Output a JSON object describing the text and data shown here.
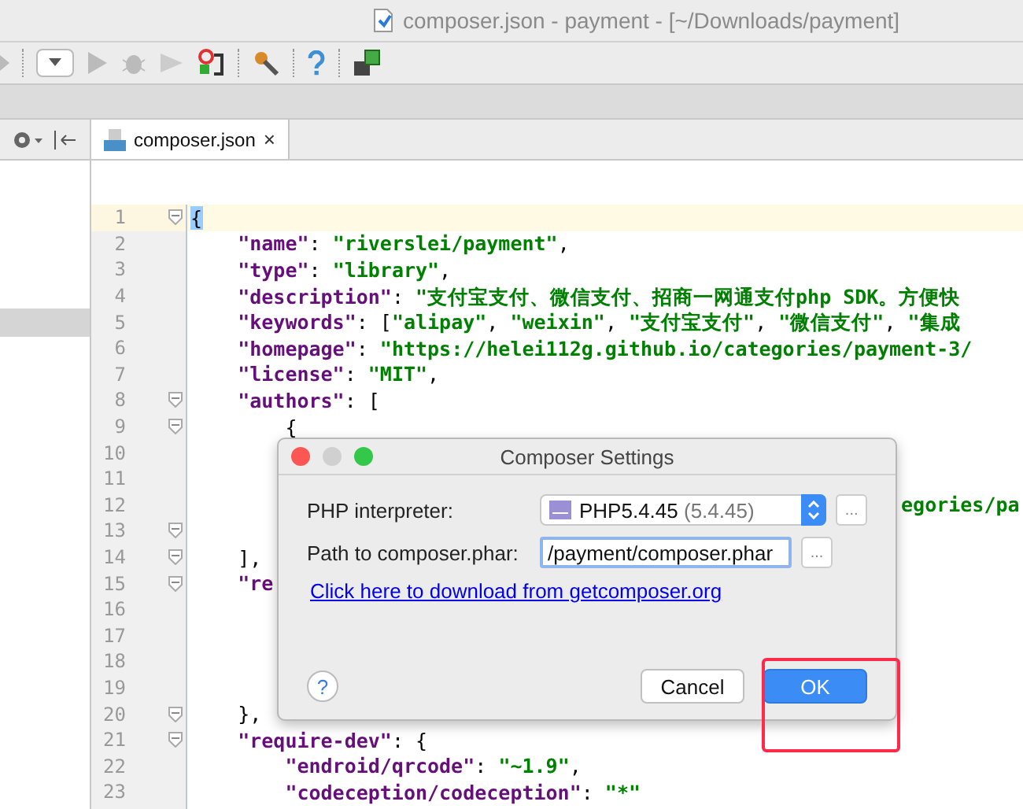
{
  "window": {
    "title": "composer.json - payment - [~/Downloads/payment]"
  },
  "tabs": [
    {
      "label": "composer.json",
      "close": "×",
      "selected": true
    }
  ],
  "editor": {
    "lines": [
      {
        "number": "1",
        "fold": true,
        "current": true,
        "tokens": [
          {
            "t": "{",
            "kind": "match"
          }
        ]
      },
      {
        "number": "2",
        "fold": false,
        "current": false,
        "tokens": [
          {
            "t": "    \"name\"",
            "kind": "key"
          },
          {
            "t": ": ",
            "kind": "p"
          },
          {
            "t": "\"riverslei/payment\"",
            "kind": "str"
          },
          {
            "t": ",",
            "kind": "p"
          }
        ]
      },
      {
        "number": "3",
        "fold": false,
        "current": false,
        "tokens": [
          {
            "t": "    \"type\"",
            "kind": "key"
          },
          {
            "t": ": ",
            "kind": "p"
          },
          {
            "t": "\"library\"",
            "kind": "str"
          },
          {
            "t": ",",
            "kind": "p"
          }
        ]
      },
      {
        "number": "4",
        "fold": false,
        "current": false,
        "tokens": [
          {
            "t": "    \"description\"",
            "kind": "key"
          },
          {
            "t": ": ",
            "kind": "p"
          },
          {
            "t": "\"支付宝支付、微信支付、招商一网通支付php SDK。方便快",
            "kind": "str"
          }
        ]
      },
      {
        "number": "5",
        "fold": false,
        "current": false,
        "tokens": [
          {
            "t": "    \"keywords\"",
            "kind": "key"
          },
          {
            "t": ": [",
            "kind": "p"
          },
          {
            "t": "\"alipay\"",
            "kind": "str"
          },
          {
            "t": ", ",
            "kind": "p"
          },
          {
            "t": "\"weixin\"",
            "kind": "str"
          },
          {
            "t": ", ",
            "kind": "p"
          },
          {
            "t": "\"支付宝支付\"",
            "kind": "str"
          },
          {
            "t": ", ",
            "kind": "p"
          },
          {
            "t": "\"微信支付\"",
            "kind": "str"
          },
          {
            "t": ", ",
            "kind": "p"
          },
          {
            "t": "\"集成",
            "kind": "str"
          }
        ]
      },
      {
        "number": "6",
        "fold": false,
        "current": false,
        "tokens": [
          {
            "t": "    \"homepage\"",
            "kind": "key"
          },
          {
            "t": ": ",
            "kind": "p"
          },
          {
            "t": "\"https://helei112g.github.io/categories/payment-3/",
            "kind": "str"
          }
        ]
      },
      {
        "number": "7",
        "fold": false,
        "current": false,
        "tokens": [
          {
            "t": "    \"license\"",
            "kind": "key"
          },
          {
            "t": ": ",
            "kind": "p"
          },
          {
            "t": "\"MIT\"",
            "kind": "str"
          },
          {
            "t": ",",
            "kind": "p"
          }
        ]
      },
      {
        "number": "8",
        "fold": true,
        "current": false,
        "tokens": [
          {
            "t": "    \"authors\"",
            "kind": "key"
          },
          {
            "t": ": [",
            "kind": "p"
          }
        ]
      },
      {
        "number": "9",
        "fold": true,
        "current": false,
        "tokens": [
          {
            "t": "        {",
            "kind": "p"
          }
        ]
      },
      {
        "number": "10",
        "fold": false,
        "current": false
      },
      {
        "number": "11",
        "fold": false,
        "current": false
      },
      {
        "number": "12",
        "fold": false,
        "current": false,
        "tokens": [
          {
            "t": "                                                            egories/pa",
            "kind": "str"
          }
        ]
      },
      {
        "number": "13",
        "fold": true,
        "current": false
      },
      {
        "number": "14",
        "fold": true,
        "current": false,
        "tokens": [
          {
            "t": "    ],",
            "kind": "p"
          }
        ]
      },
      {
        "number": "15",
        "fold": true,
        "current": false,
        "tokens": [
          {
            "t": "    \"re",
            "kind": "key"
          }
        ]
      },
      {
        "number": "16",
        "fold": false,
        "current": false
      },
      {
        "number": "17",
        "fold": false,
        "current": false
      },
      {
        "number": "18",
        "fold": false,
        "current": false
      },
      {
        "number": "19",
        "fold": false,
        "current": false
      },
      {
        "number": "20",
        "fold": true,
        "current": false,
        "tokens": [
          {
            "t": "    },",
            "kind": "p"
          }
        ]
      },
      {
        "number": "21",
        "fold": true,
        "current": false,
        "tokens": [
          {
            "t": "    \"require-dev\"",
            "kind": "key"
          },
          {
            "t": ": {",
            "kind": "p"
          }
        ]
      },
      {
        "number": "22",
        "fold": false,
        "current": false,
        "tokens": [
          {
            "t": "        \"endroid/qrcode\"",
            "kind": "key"
          },
          {
            "t": ": ",
            "kind": "p"
          },
          {
            "t": "\"~1.9\"",
            "kind": "str"
          },
          {
            "t": ",",
            "kind": "p"
          }
        ]
      },
      {
        "number": "23",
        "fold": false,
        "current": false,
        "tokens": [
          {
            "t": "        \"codeception/codeception\"",
            "kind": "key"
          },
          {
            "t": ": ",
            "kind": "p"
          },
          {
            "t": "\"*\"",
            "kind": "str"
          }
        ]
      }
    ]
  },
  "dialog": {
    "title": "Composer Settings",
    "interpreter": {
      "label": "PHP interpreter:",
      "value": "PHP5.4.45",
      "version": "(5.4.45)",
      "browse": "..."
    },
    "path": {
      "label": "Path to composer.phar:",
      "value": "/payment/composer.phar",
      "browse": "..."
    },
    "link": "Click here to download from getcomposer.org",
    "help": "?",
    "buttons": [
      {
        "label": "Cancel",
        "kind": "normal"
      },
      {
        "label": "OK",
        "kind": "default"
      }
    ],
    "highlight_ok": true
  }
}
